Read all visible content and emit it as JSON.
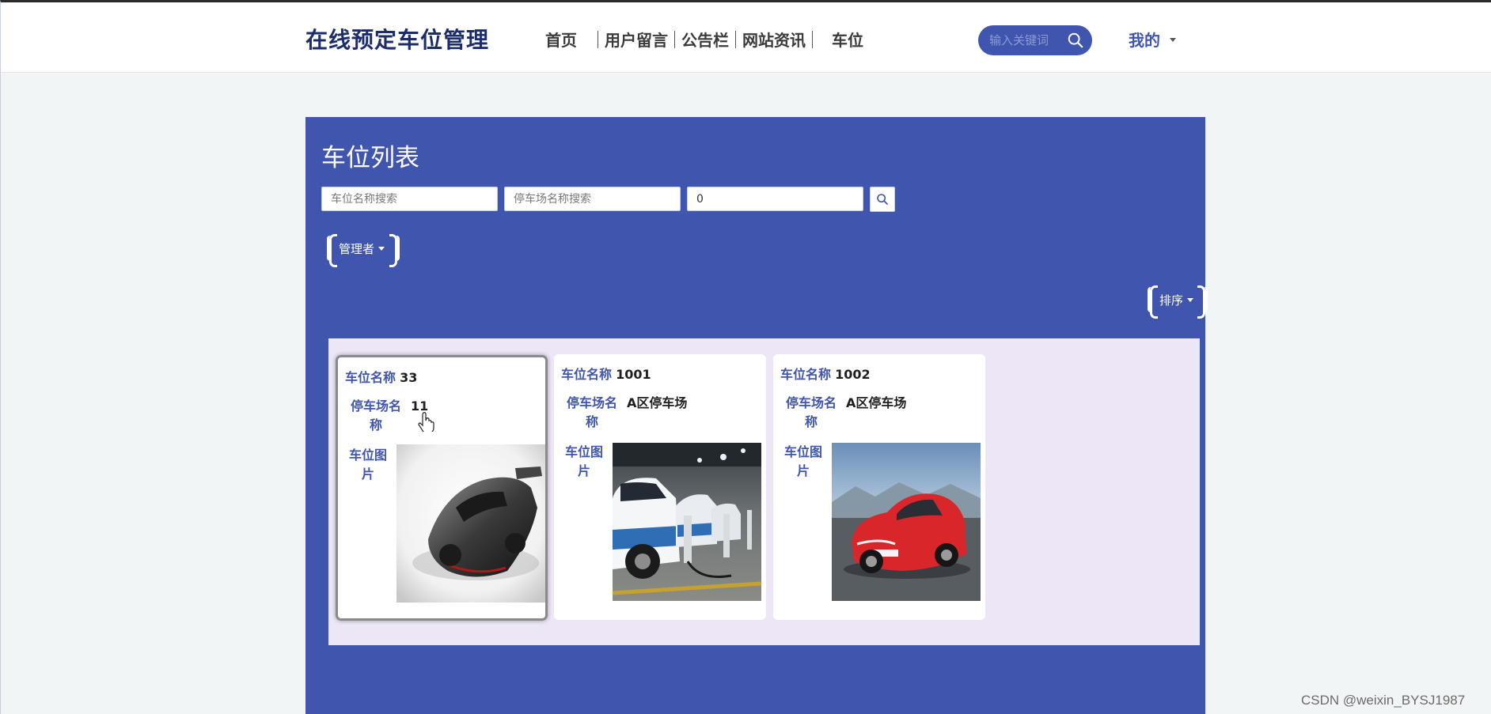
{
  "header": {
    "brand": "在线预定车位管理",
    "nav": [
      "首页",
      "用户留言",
      "公告栏",
      "网站资讯",
      "车位"
    ],
    "search_placeholder": "输入关键词",
    "mine_label": "我的"
  },
  "panel": {
    "title": "车位列表",
    "filters": {
      "spot_name_placeholder": "车位名称搜索",
      "lot_name_placeholder": "停车场名称搜索",
      "third_value": "0"
    },
    "admin_button": "管理者",
    "sort_button": "排序"
  },
  "cards": [
    {
      "spot_label": "车位名称",
      "spot_value": "33",
      "lot_label": "停车场名称",
      "lot_value": "11",
      "image_label": "车位图片",
      "image_icon": "black-sports-car"
    },
    {
      "spot_label": "车位名称",
      "spot_value": "1001",
      "lot_label": "停车场名称",
      "lot_value": "A区停车场",
      "image_label": "车位图片",
      "image_icon": "ev-charging-row"
    },
    {
      "spot_label": "车位名称",
      "spot_value": "1002",
      "lot_label": "停车场名称",
      "lot_value": "A区停车场",
      "image_label": "车位图片",
      "image_icon": "red-sports-car"
    }
  ],
  "watermark": "CSDN @weixin_BYSJ1987",
  "colors": {
    "primary": "#3f55ae",
    "grid_bg": "#ece6f6",
    "page_bg": "#f2f5f6"
  }
}
